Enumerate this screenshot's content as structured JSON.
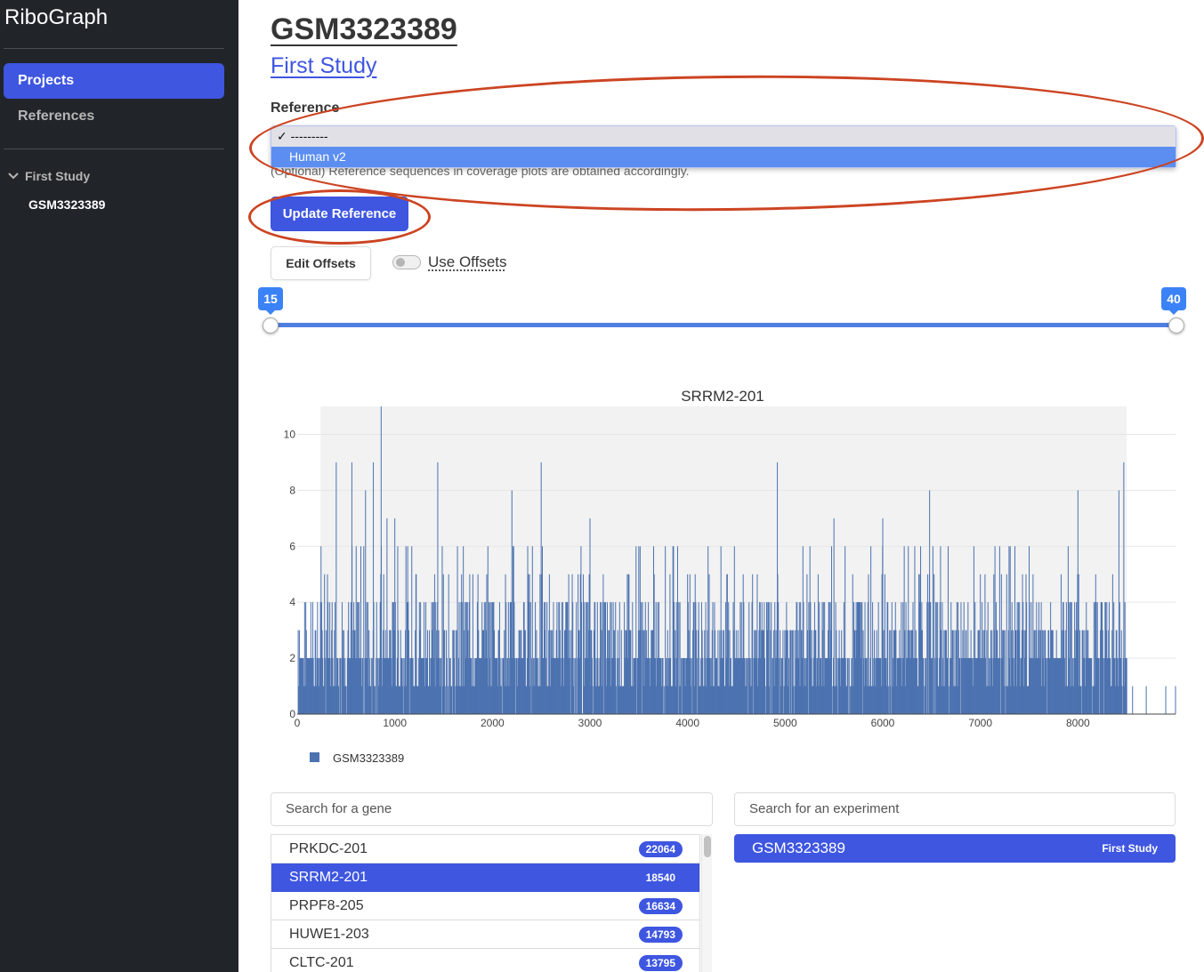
{
  "app": {
    "brand": "RiboGraph"
  },
  "sidebar": {
    "nav": [
      {
        "label": "Projects",
        "active": true
      },
      {
        "label": "References",
        "active": false
      }
    ],
    "tree": {
      "parent": "First Study",
      "child": "GSM3323389"
    }
  },
  "header": {
    "title": "GSM3323389",
    "subtitle": "First Study"
  },
  "reference": {
    "label": "Reference",
    "options": [
      "---------",
      "Human v2"
    ],
    "selected_option": "---------",
    "highlighted_option": "Human v2",
    "help_text": "(Optional) Reference sequences in coverage plots are obtained accordingly."
  },
  "buttons": {
    "update_reference": "Update Reference",
    "edit_offsets": "Edit Offsets"
  },
  "offsets_toggle": {
    "label": "Use Offsets",
    "on": false
  },
  "slider": {
    "min_label": "15",
    "max_label": "40"
  },
  "chart_data": {
    "type": "bar",
    "title": "SRRM2-201",
    "legend": [
      "GSM3323389"
    ],
    "x_ticks": [
      "0",
      "1000",
      "2000",
      "3000",
      "4000",
      "5000",
      "6000",
      "7000",
      "8000"
    ],
    "y_ticks": [
      "0",
      "2",
      "4",
      "6",
      "8",
      "10"
    ],
    "xlim": [
      0,
      9000
    ],
    "ylim": [
      0,
      11
    ],
    "shaded_region": [
      240,
      8500
    ],
    "series": [
      {
        "name": "GSM3323389",
        "color": "#4c72b0",
        "peaks": [
          [
            140,
            4
          ],
          [
            280,
            5
          ],
          [
            400,
            9
          ],
          [
            560,
            9
          ],
          [
            700,
            8
          ],
          [
            780,
            9
          ],
          [
            860,
            11
          ],
          [
            920,
            7
          ],
          [
            1000,
            7
          ],
          [
            1220,
            5
          ],
          [
            1440,
            9
          ],
          [
            1800,
            5
          ],
          [
            2200,
            8
          ],
          [
            2500,
            9
          ],
          [
            3000,
            7
          ],
          [
            3500,
            6
          ],
          [
            4000,
            5
          ],
          [
            4480,
            6
          ],
          [
            4920,
            9
          ],
          [
            5500,
            7
          ],
          [
            6000,
            7
          ],
          [
            6480,
            8
          ],
          [
            7000,
            5
          ],
          [
            7500,
            6
          ],
          [
            7900,
            6
          ],
          [
            8000,
            8
          ],
          [
            8420,
            8
          ],
          [
            8470,
            9
          ],
          [
            8560,
            1
          ],
          [
            8700,
            1
          ],
          [
            8900,
            1
          ],
          [
            9000,
            1
          ]
        ]
      }
    ]
  },
  "gene_search": {
    "placeholder": "Search for a gene"
  },
  "experiment_search": {
    "placeholder": "Search for an experiment"
  },
  "genes": [
    {
      "name": "PRKDC-201",
      "count": "22064",
      "active": false
    },
    {
      "name": "SRRM2-201",
      "count": "18540",
      "active": true
    },
    {
      "name": "PRPF8-205",
      "count": "16634",
      "active": false
    },
    {
      "name": "HUWE1-203",
      "count": "14793",
      "active": false
    },
    {
      "name": "CLTC-201",
      "count": "13795",
      "active": false
    }
  ],
  "experiments": [
    {
      "name": "GSM3323389",
      "project": "First Study"
    }
  ],
  "colors": {
    "accent": "#3e56e0",
    "sidebar_bg": "#212529",
    "annotation": "#cc4422"
  }
}
